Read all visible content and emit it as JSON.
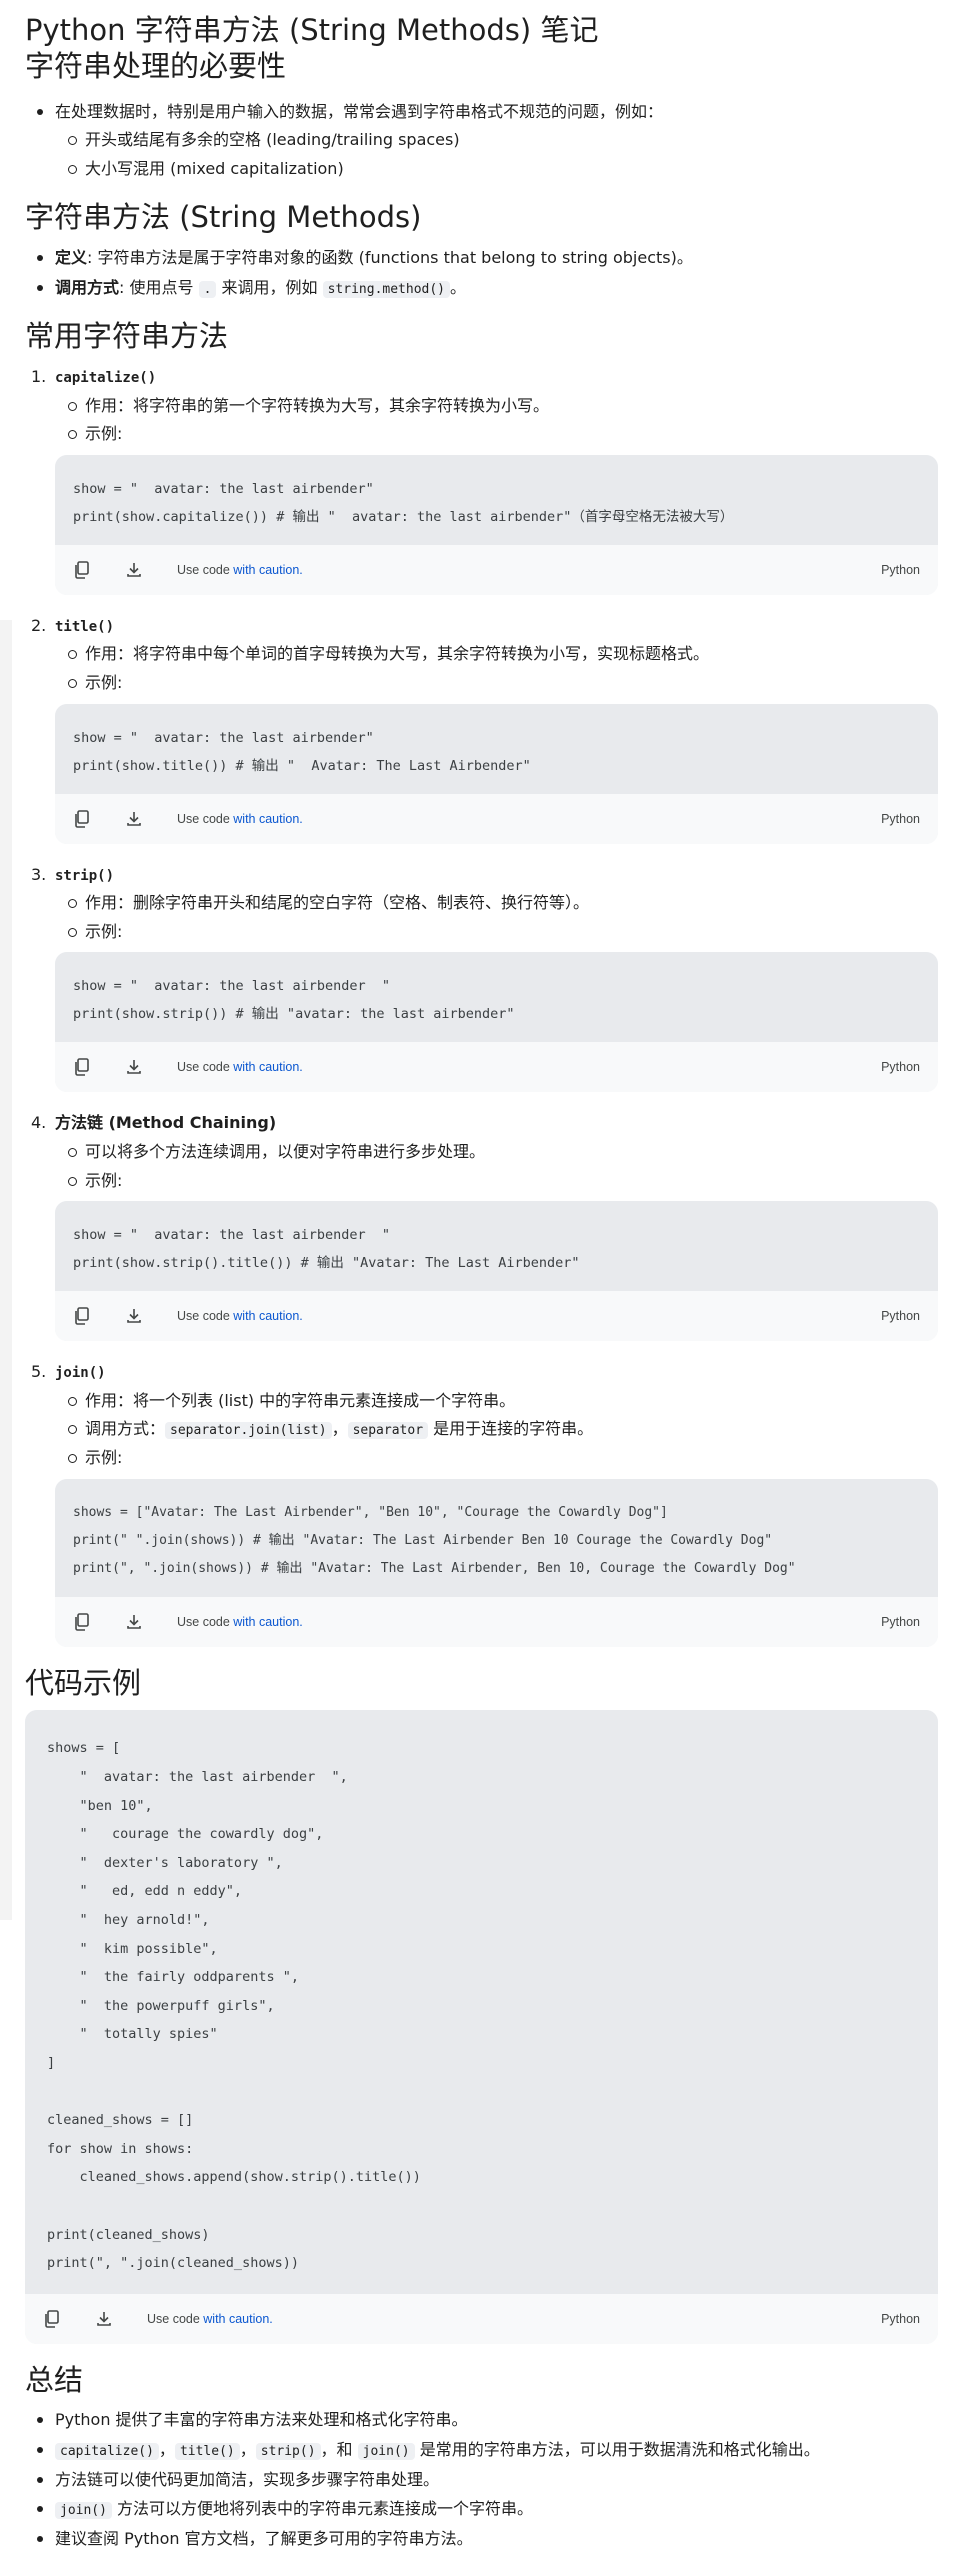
{
  "header": {
    "title": "Python 字符串方法 (String Methods) 笔记",
    "subtitle": "字符串处理的必要性"
  },
  "intro": {
    "text": "在处理数据时，特别是用户输入的数据，常常会遇到字符串格式不规范的问题，例如：",
    "sub": [
      "开头或结尾有多余的空格 (leading/trailing spaces)",
      "大小写混用 (mixed capitalization)"
    ]
  },
  "methods_section": {
    "title": "字符串方法 (String Methods)",
    "def_label": "定义",
    "def_text": ": 字符串方法是属于字符串对象的函数 (functions that belong to string objects)。",
    "call_label": "调用方式",
    "call_text_1": ": 使用点号 ",
    "call_dot": ".",
    "call_text_2": " 来调用，例如 ",
    "call_code": "string.method()",
    "call_text_3": "。"
  },
  "common_section": {
    "title": "常用字符串方法",
    "effect_label": "作用：",
    "example_label": "示例:"
  },
  "steps": {
    "s1": {
      "num": "1.",
      "name": "capitalize()",
      "desc": "将字符串的第一个字符转换为大写，其余字符转换为小写。",
      "code": [
        "show = \"  avatar: the last airbender\"",
        "print(show.capitalize()) # 输出 \"  avatar: the last airbender\"（首字母空格无法被大写）"
      ]
    },
    "s2": {
      "num": "2.",
      "name": "title()",
      "desc": "将字符串中每个单词的首字母转换为大写，其余字符转换为小写，实现标题格式。",
      "code": [
        "show = \"  avatar: the last airbender\"",
        "print(show.title()) # 输出 \"  Avatar: The Last Airbender\""
      ]
    },
    "s3": {
      "num": "3.",
      "name": "strip()",
      "desc": "删除字符串开头和结尾的空白字符（空格、制表符、换行符等）。",
      "code": [
        "show = \"  avatar: the last airbender  \"",
        "print(show.strip()) # 输出 \"avatar: the last airbender\""
      ]
    },
    "s4": {
      "num": "4.",
      "name": "方法链 (Method Chaining)",
      "desc": "可以将多个方法连续调用，以便对字符串进行多步处理。",
      "code": [
        "show = \"  avatar: the last airbender  \"",
        "print(show.strip().title()) # 输出 \"Avatar: The Last Airbender\""
      ]
    },
    "s5": {
      "num": "5.",
      "name": "join()",
      "desc": "将一个列表 (list) 中的字符串元素连接成一个字符串。",
      "usage_label": "调用方式：",
      "usage_code": "separator.join(list)",
      "usage_sep": "，",
      "usage_code2": "separator",
      "usage_tail": " 是用于连接的字符串。",
      "code": [
        "shows = [\"Avatar: The Last Airbender\", \"Ben 10\", \"Courage the Cowardly Dog\"]",
        "print(\" \".join(shows)) # 输出 \"Avatar: The Last Airbender Ben 10 Courage the Cowardly Dog\"",
        "print(\", \".join(shows)) # 输出 \"Avatar: The Last Airbender, Ben 10, Courage the Cowardly Dog\""
      ]
    }
  },
  "code_footer": {
    "use_code": "Use code ",
    "caution": "with caution.",
    "lang": "Python"
  },
  "example_section": {
    "title": "代码示例",
    "code": "shows = [\n    \"  avatar: the last airbender  \",\n    \"ben 10\",\n    \"   courage the cowardly dog\",\n    \"  dexter's laboratory \",\n    \"   ed, edd n eddy\",\n    \"  hey arnold!\",\n    \"  kim possible\",\n    \"  the fairly oddparents \",\n    \"  the powerpuff girls\",\n    \"  totally spies\"\n]\n\ncleaned_shows = []\nfor show in shows:\n    cleaned_shows.append(show.strip().title())\n\nprint(cleaned_shows)\nprint(\", \".join(cleaned_shows))"
  },
  "summary": {
    "title": "总结",
    "b1": "Python 提供了丰富的字符串方法来处理和格式化字符串。",
    "b2_codes": [
      "capitalize()",
      "title()",
      "strip()",
      "join()"
    ],
    "b2_sep1": "，",
    "b2_sep2": "，",
    "b2_sep3": "，和 ",
    "b2_text": " 是常用的字符串方法，可以用于数据清洗和格式化输出。",
    "b3": "方法链可以使代码更加简洁，实现多步骤字符串处理。",
    "b4_code": "join()",
    "b4_text": " 方法可以方便地将列表中的字符串元素连接成一个字符串。",
    "b5": "建议查阅 Python 官方文档，了解更多可用的字符串方法。"
  },
  "icons": {
    "copy": "copy-icon",
    "download": "download-icon"
  }
}
